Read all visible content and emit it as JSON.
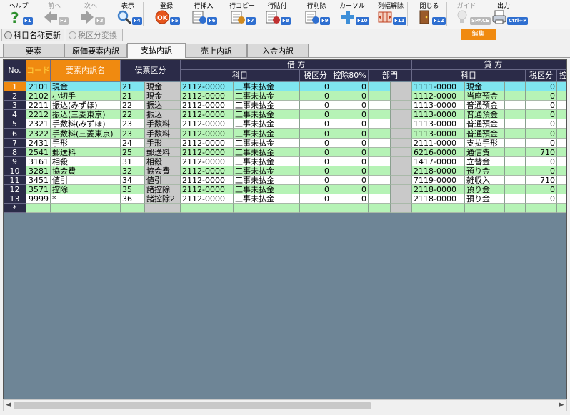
{
  "toolbar": {
    "buttons": [
      {
        "label": "ヘルプ",
        "fkey": "F1",
        "icon": "help-icon",
        "enabled": true
      },
      {
        "label": "前へ",
        "fkey": "F2",
        "icon": "arrow-left-icon",
        "enabled": false
      },
      {
        "label": "次へ",
        "fkey": "F3",
        "icon": "arrow-right-icon",
        "enabled": false
      },
      {
        "label": "表示",
        "fkey": "F4",
        "icon": "magnifier-icon",
        "enabled": true
      },
      {
        "label": "登録",
        "fkey": "F5",
        "icon": "ok-icon",
        "enabled": true
      },
      {
        "label": "行挿入",
        "fkey": "F6",
        "icon": "row-insert-icon",
        "enabled": true
      },
      {
        "label": "行コピー",
        "fkey": "F7",
        "icon": "row-copy-icon",
        "enabled": true
      },
      {
        "label": "行貼付",
        "fkey": "F8",
        "icon": "row-paste-icon",
        "enabled": true
      },
      {
        "label": "行削除",
        "fkey": "F9",
        "icon": "row-delete-icon",
        "enabled": true
      },
      {
        "label": "カーソル",
        "fkey": "F10",
        "icon": "cursor-cross-icon",
        "enabled": true
      },
      {
        "label": "列幅解除",
        "fkey": "F11",
        "icon": "column-width-icon",
        "enabled": true
      },
      {
        "label": "閉じる",
        "fkey": "F12",
        "icon": "exit-door-icon",
        "enabled": true
      },
      {
        "label": "ガイド",
        "fkey": "SPACE",
        "icon": "lightbulb-icon",
        "enabled": false
      },
      {
        "label": "出力",
        "fkey": "Ctrl+P",
        "icon": "printer-icon",
        "enabled": true
      }
    ]
  },
  "edit_badge": "編集",
  "subbuttons": {
    "rename": "科目名称更新",
    "tax_convert": "税区分変換"
  },
  "tabs": [
    "要素",
    "原価要素内訳",
    "支払内訳",
    "売上内訳",
    "入金内訳"
  ],
  "active_tab": "支払内訳",
  "grid": {
    "headers": {
      "no": "No.",
      "code": "コード",
      "name": "要素内訳名",
      "slip": "伝票区分",
      "debit": "借 方",
      "credit": "貸 方",
      "account": "科目",
      "tax": "税区分",
      "deduct": "控除80%",
      "dept": "部門",
      "credit_tax": "税区分",
      "credit_deduct": "控"
    },
    "rows": [
      {
        "no": "1",
        "code": "2101",
        "name": "現金",
        "slip_code": "21",
        "slip_name": "現金",
        "d_code": "2112-0000",
        "d_name": "工事未払金",
        "d_tax": "0",
        "d_ded": "0",
        "c_code": "1111-0000",
        "c_name": "現金",
        "c_tax": "0"
      },
      {
        "no": "2",
        "code": "2102",
        "name": "小切手",
        "slip_code": "21",
        "slip_name": "現金",
        "d_code": "2112-0000",
        "d_name": "工事未払金",
        "d_tax": "0",
        "d_ded": "0",
        "c_code": "1112-0000",
        "c_name": "当座預金",
        "c_tax": "0"
      },
      {
        "no": "3",
        "code": "2211",
        "name": "振込(みずほ)",
        "slip_code": "22",
        "slip_name": "振込",
        "d_code": "2112-0000",
        "d_name": "工事未払金",
        "d_tax": "0",
        "d_ded": "0",
        "c_code": "1113-0000",
        "c_name": "普通預金",
        "c_tax": "0"
      },
      {
        "no": "4",
        "code": "2212",
        "name": "振込(三菱東京)",
        "slip_code": "22",
        "slip_name": "振込",
        "d_code": "2112-0000",
        "d_name": "工事未払金",
        "d_tax": "0",
        "d_ded": "0",
        "c_code": "1113-0000",
        "c_name": "普通預金",
        "c_tax": "0"
      },
      {
        "no": "5",
        "code": "2321",
        "name": "手数料(みずほ)",
        "slip_code": "23",
        "slip_name": "手数料",
        "d_code": "2112-0000",
        "d_name": "工事未払金",
        "d_tax": "0",
        "d_ded": "0",
        "c_code": "1113-0000",
        "c_name": "普通預金",
        "c_tax": "0"
      },
      {
        "no": "6",
        "code": "2322",
        "name": "手数料(三菱東京)",
        "slip_code": "23",
        "slip_name": "手数料",
        "d_code": "2112-0000",
        "d_name": "工事未払金",
        "d_tax": "0",
        "d_ded": "0",
        "c_code": "1113-0000",
        "c_name": "普通預金",
        "c_tax": "0"
      },
      {
        "no": "7",
        "code": "2431",
        "name": "手形",
        "slip_code": "24",
        "slip_name": "手形",
        "d_code": "2112-0000",
        "d_name": "工事未払金",
        "d_tax": "0",
        "d_ded": "0",
        "c_code": "2111-0000",
        "c_name": "支払手形",
        "c_tax": "0"
      },
      {
        "no": "8",
        "code": "2541",
        "name": "郵送料",
        "slip_code": "25",
        "slip_name": "郵送料",
        "d_code": "2112-0000",
        "d_name": "工事未払金",
        "d_tax": "0",
        "d_ded": "0",
        "c_code": "6216-0000",
        "c_name": "通信費",
        "c_tax": "710"
      },
      {
        "no": "9",
        "code": "3161",
        "name": "相殺",
        "slip_code": "31",
        "slip_name": "相殺",
        "d_code": "2112-0000",
        "d_name": "工事未払金",
        "d_tax": "0",
        "d_ded": "0",
        "c_code": "1417-0000",
        "c_name": "立替金",
        "c_tax": "0"
      },
      {
        "no": "10",
        "code": "3281",
        "name": "協会費",
        "slip_code": "32",
        "slip_name": "協会費",
        "d_code": "2112-0000",
        "d_name": "工事未払金",
        "d_tax": "0",
        "d_ded": "0",
        "c_code": "2118-0000",
        "c_name": "預り金",
        "c_tax": "0"
      },
      {
        "no": "11",
        "code": "3451",
        "name": "値引",
        "slip_code": "34",
        "slip_name": "値引",
        "d_code": "2112-0000",
        "d_name": "工事未払金",
        "d_tax": "0",
        "d_ded": "0",
        "c_code": "7119-0000",
        "c_name": "雑収入",
        "c_tax": "710"
      },
      {
        "no": "12",
        "code": "3571",
        "name": "控除",
        "slip_code": "35",
        "slip_name": "諸控除",
        "d_code": "2112-0000",
        "d_name": "工事未払金",
        "d_tax": "0",
        "d_ded": "0",
        "c_code": "2118-0000",
        "c_name": "預り金",
        "c_tax": "0"
      },
      {
        "no": "13",
        "code": "9999",
        "name": "*",
        "slip_code": "36",
        "slip_name": "諸控除2",
        "d_code": "2112-0000",
        "d_name": "工事未払金",
        "d_tax": "0",
        "d_ded": "0",
        "c_code": "2118-0000",
        "c_name": "預り金",
        "c_tax": "0"
      }
    ],
    "new_row_marker": "*"
  },
  "colors": {
    "header_bg": "#2b2b48",
    "accent_orange": "#f08a10",
    "row_white": "#ffffff",
    "row_green": "#b6f3b6",
    "row_selected": "#7fe6f0",
    "grid_background": "#6e8596"
  }
}
